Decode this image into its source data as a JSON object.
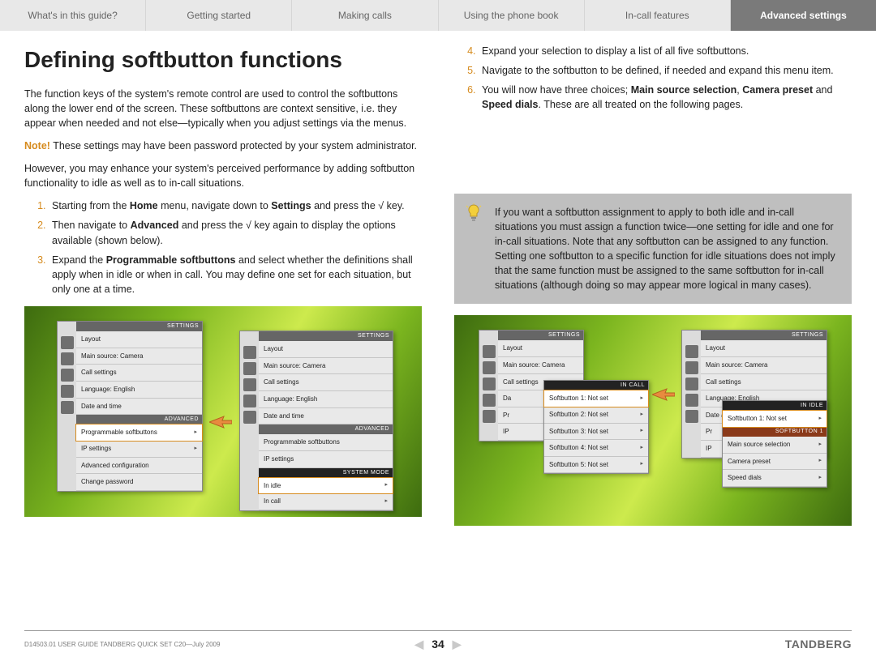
{
  "tabs": [
    "What's in this guide?",
    "Getting started",
    "Making calls",
    "Using the phone book",
    "In-call features",
    "Advanced settings"
  ],
  "active_tab": 5,
  "left": {
    "title": "Defining softbutton functions",
    "p1": "The function keys of the system's remote control are used to control the softbuttons along the lower end of the screen. These softbuttons are context sensitive, i.e. they appear when needed and not else—typically when you adjust settings via the menus.",
    "note_label": "Note!",
    "p2": " These settings may have been password protected by your system administrator.",
    "p3": "However, you may enhance your system's perceived performance by adding softbutton functionality to idle as well as to in-call situations.",
    "ol": [
      {
        "pre": "Starting from the ",
        "b1": "Home",
        "mid": " menu, navigate down to ",
        "b2": "Settings",
        "post": " and press the √ key."
      },
      {
        "pre": "Then navigate to ",
        "b1": "Advanced",
        "mid": " and press the √ key again to display the options available (shown below).",
        "b2": "",
        "post": ""
      },
      {
        "pre": "Expand the ",
        "b1": "Programmable softbuttons",
        "mid": " and select whether the definitions shall apply when in idle or when in call. You may define one set for each situation, but only one at a time.",
        "b2": "",
        "post": ""
      }
    ]
  },
  "right": {
    "ol": [
      "Expand your selection to display a list of all five softbuttons.",
      "Navigate to the softbutton to be defined, if needed and expand this menu item.",
      {
        "pre": "You will now have three choices; ",
        "b1": "Main source selection",
        "sep1": ", ",
        "b2": "Camera preset",
        "sep2": " and ",
        "b3": "Speed dials",
        "post": ". These are all treated on the following pages."
      }
    ],
    "tip": "If you want a softbutton assignment to apply to both idle and in-call situations you must assign a function twice—one setting for idle and one for in-call situations. Note that any softbutton can be assigned to any function. Setting one softbutton to a specific function for idle situations does not imply that the same function must be assigned to the same softbutton for in-call situations (although doing so may appear more logical in many cases)."
  },
  "ui": {
    "settings_title": "SETTINGS",
    "advanced_title": "ADVANCED",
    "system_mode_title": "SYSTEM MODE",
    "in_call_title": "IN CALL",
    "in_idle_title": "IN IDLE",
    "softbutton_title": "SOFTBUTTON 1",
    "settings_rows": [
      "Layout",
      "Main source: Camera",
      "Call settings",
      "Language: English",
      "Date and time"
    ],
    "advanced_rows": [
      "Programmable softbuttons",
      "IP settings",
      "Advanced configuration",
      "Change password"
    ],
    "mode_rows": [
      "In idle",
      "In call"
    ],
    "incall_rows": [
      "Softbutton 1: Not set",
      "Softbutton 2: Not set",
      "Softbutton 3: Not set",
      "Softbutton 4: Not set",
      "Softbutton 5: Not set"
    ],
    "inidle_rows": [
      "Softbutton 1: Not set"
    ],
    "sb_rows": [
      "Main source selection",
      "Camera preset",
      "Speed dials"
    ]
  },
  "footer": {
    "doc": "D14503.01 USER GUIDE TANDBERG QUICK SET C20—July 2009",
    "page": "34",
    "brand": "TANDBERG"
  }
}
